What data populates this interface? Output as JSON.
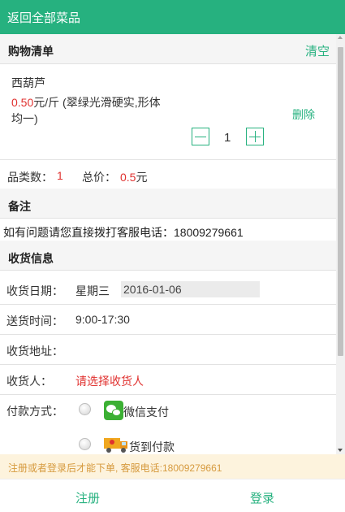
{
  "header": {
    "back_label": "返回全部菜品"
  },
  "cart": {
    "title": "购物清单",
    "clear_label": "清空",
    "item": {
      "name": "西葫芦",
      "price": "0.50",
      "unit": "元/斤",
      "desc_line1": " (翠绿光滑硬实,形体",
      "desc_line2": "均一)",
      "delete_label": "删除",
      "quantity": "1"
    },
    "summary": {
      "kinds_label": "品类数：",
      "kinds_value": "1",
      "total_label": "总价：",
      "total_value": "0.5",
      "total_unit": "元"
    }
  },
  "remark": {
    "title": "备注",
    "text": "如有问题请您直接拨打客服电话：18009279661"
  },
  "delivery": {
    "title": "收货信息",
    "date_label": "收货日期：",
    "weekday": "星期三",
    "date_value": "2016-01-06",
    "time_label": "送货时间：",
    "time_value": "9:00-17:30",
    "address_label": "收货地址：",
    "receiver_label": "收货人：",
    "receiver_prompt": "请选择收货人",
    "payment_label": "付款方式：",
    "pay_wechat": "微信支付",
    "pay_cod": "货到付款"
  },
  "notice": {
    "text": "注册或者登录后才能下单, 客服电话:18009279661"
  },
  "footer": {
    "register_label": "注册",
    "login_label": "登录"
  },
  "colors": {
    "accent": "#26b17f",
    "price_red": "#e0312f",
    "notice_bg": "#fdf3dd",
    "notice_text": "#d69a3e"
  }
}
